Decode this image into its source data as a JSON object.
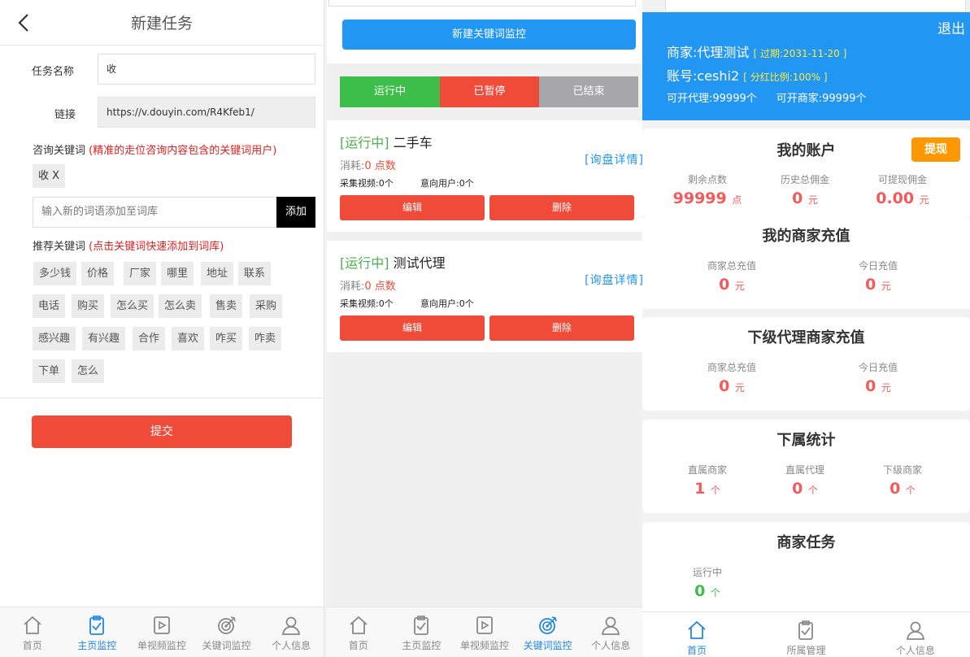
{
  "task_form": {
    "title": "新建任务",
    "name_label": "任务名称",
    "name_value": "收",
    "link_label": "链接",
    "link_value": "https://v.douyin.com/R4Kfeb1/",
    "consult_label": "咨询关键词",
    "consult_hint": "(精准的走位咨询内容包含的关键词用户)",
    "selected_keyword": "收 X",
    "new_keyword_placeholder": "输入新的词语添加至词库",
    "add_label": "添加",
    "recommend_label": "推荐关键词",
    "recommend_hint": "(点击关键词快速添加到词库)",
    "recommended": [
      "多少钱",
      "价格",
      "厂家",
      "哪里",
      "地址",
      "联系",
      "电话",
      "购买",
      "怎么买",
      "怎么卖",
      "售卖",
      "采购",
      "感兴趣",
      "有兴趣",
      "合作",
      "喜欢",
      "咋买",
      "咋卖",
      "下单",
      "怎么"
    ],
    "submit_label": "提交"
  },
  "tabbar1": [
    {
      "label": "首页",
      "icon": "home-icon"
    },
    {
      "label": "主页监控",
      "icon": "clipboard-check-icon",
      "active": true
    },
    {
      "label": "单视频监控",
      "icon": "video-icon"
    },
    {
      "label": "关键词监控",
      "icon": "target-icon"
    },
    {
      "label": "个人信息",
      "icon": "user-icon"
    }
  ],
  "monitor": {
    "new_label": "新建关键词监控",
    "segments": [
      {
        "label": "运行中",
        "color": "#3dbd4a"
      },
      {
        "label": "已暂停",
        "color": "#f04a38"
      },
      {
        "label": "已结束",
        "color": "#a6a6ab"
      }
    ],
    "cards": [
      {
        "status": "[运行中]",
        "name": "二手车",
        "detail": "[询盘详情]",
        "consume_label": "消耗:",
        "consume_value": "0 点数",
        "videos": "采集视频:0个",
        "users": "意向用户:0个",
        "edit": "编辑",
        "delete": "删除"
      },
      {
        "status": "[运行中]",
        "name": "测试代理",
        "detail": "[询盘详情]",
        "consume_label": "消耗:",
        "consume_value": "0 点数",
        "videos": "采集视频:0个",
        "users": "意向用户:0个",
        "edit": "编辑",
        "delete": "删除"
      }
    ]
  },
  "tabbar2": [
    {
      "label": "首页",
      "icon": "home-icon"
    },
    {
      "label": "主页监控",
      "icon": "clipboard-check-icon"
    },
    {
      "label": "单视频监控",
      "icon": "video-icon"
    },
    {
      "label": "关键词监控",
      "icon": "target-icon",
      "active": true
    },
    {
      "label": "个人信息",
      "icon": "user-icon"
    }
  ],
  "profile": {
    "exit": "退出",
    "merchant_label": "商家:",
    "merchant_name": "代理测试",
    "expiry": "[ 过期:2031-11-20 ]",
    "account_label": "账号:",
    "account": "ceshi2",
    "ratio": "[ 分红比例:100% ]",
    "agents": "可开代理:99999个",
    "merchants": "可开商家:99999个"
  },
  "account": {
    "title": "我的账户",
    "withdraw": "提现",
    "stats": [
      {
        "k": "剩余点数",
        "v": "99999",
        "u": "点"
      },
      {
        "k": "历史总佣金",
        "v": "0",
        "u": "元"
      },
      {
        "k": "可提现佣金",
        "v": "0.00",
        "u": "元"
      }
    ]
  },
  "recharge": {
    "title": "我的商家充值",
    "stats": [
      {
        "k": "商家总充值",
        "v": "0",
        "u": "元"
      },
      {
        "k": "今日充值",
        "v": "0",
        "u": "元"
      }
    ]
  },
  "sub_recharge": {
    "title": "下级代理商家充值",
    "stats": [
      {
        "k": "商家总充值",
        "v": "0",
        "u": "元"
      },
      {
        "k": "今日充值",
        "v": "0",
        "u": "元"
      }
    ]
  },
  "sub_stats": {
    "title": "下属统计",
    "stats": [
      {
        "k": "直属商家",
        "v": "1",
        "u": "个"
      },
      {
        "k": "直属代理",
        "v": "0",
        "u": "个"
      },
      {
        "k": "下级商家",
        "v": "0",
        "u": "个"
      }
    ]
  },
  "merchant_tasks": {
    "title": "商家任务",
    "stats": [
      {
        "k": "运行中",
        "v": "0",
        "u": "个"
      }
    ]
  },
  "tabbar3": [
    {
      "label": "首页",
      "icon": "home-icon",
      "active": true
    },
    {
      "label": "所属管理",
      "icon": "clipboard-check-icon"
    },
    {
      "label": "个人信息",
      "icon": "user-icon"
    }
  ]
}
